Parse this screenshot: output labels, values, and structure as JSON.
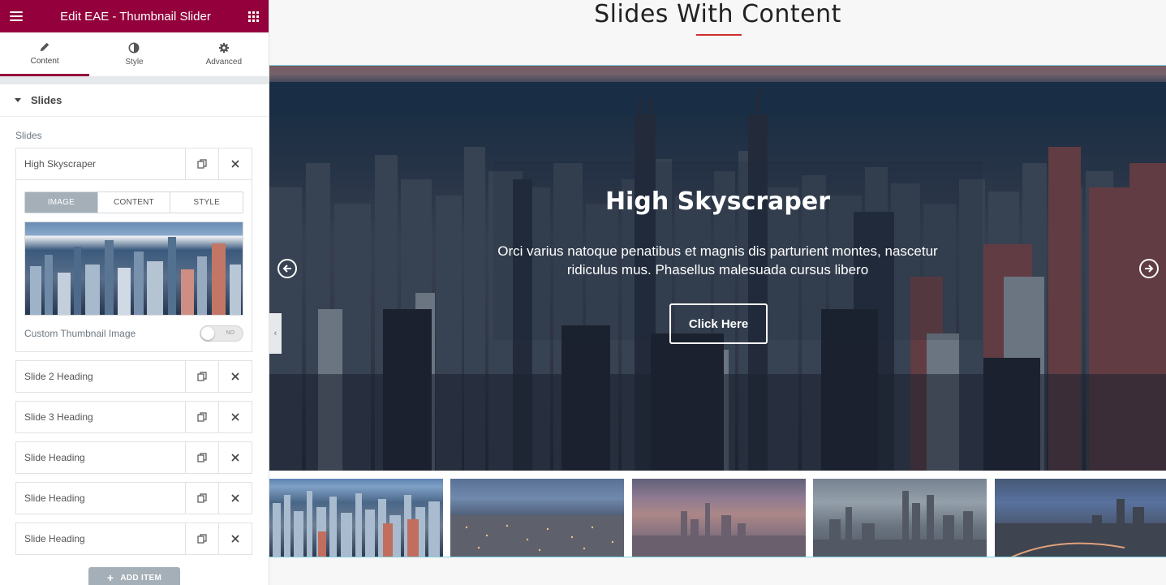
{
  "panel": {
    "title": "Edit EAE - Thumbnail Slider",
    "tabs": [
      {
        "label": "Content",
        "icon": "pencil-icon",
        "active": true
      },
      {
        "label": "Style",
        "icon": "half-circle-icon",
        "active": false
      },
      {
        "label": "Advanced",
        "icon": "gear-icon",
        "active": false
      }
    ],
    "section_title": "Slides",
    "control_label": "Slides",
    "open_item": {
      "label": "High Skyscraper",
      "subtabs": [
        "IMAGE",
        "CONTENT",
        "STYLE"
      ],
      "active_subtab": "IMAGE",
      "switch_label": "Custom Thumbnail Image",
      "switch_value": "NO"
    },
    "items": [
      "Slide 2 Heading",
      "Slide 3 Heading",
      "Slide Heading",
      "Slide Heading",
      "Slide Heading"
    ],
    "add_item_label": "ADD ITEM",
    "brand_color": "#93003c"
  },
  "preview": {
    "page_title": "Slides With Content",
    "accent_line_color": "#cf2e2e",
    "slide": {
      "heading": "High Skyscraper",
      "description": "Orci varius natoque penatibus et magnis dis parturient montes, nascetur ridiculus mus. Phasellus malesuada cursus libero",
      "button": "Click Here"
    },
    "thumbnail_count": 5
  }
}
